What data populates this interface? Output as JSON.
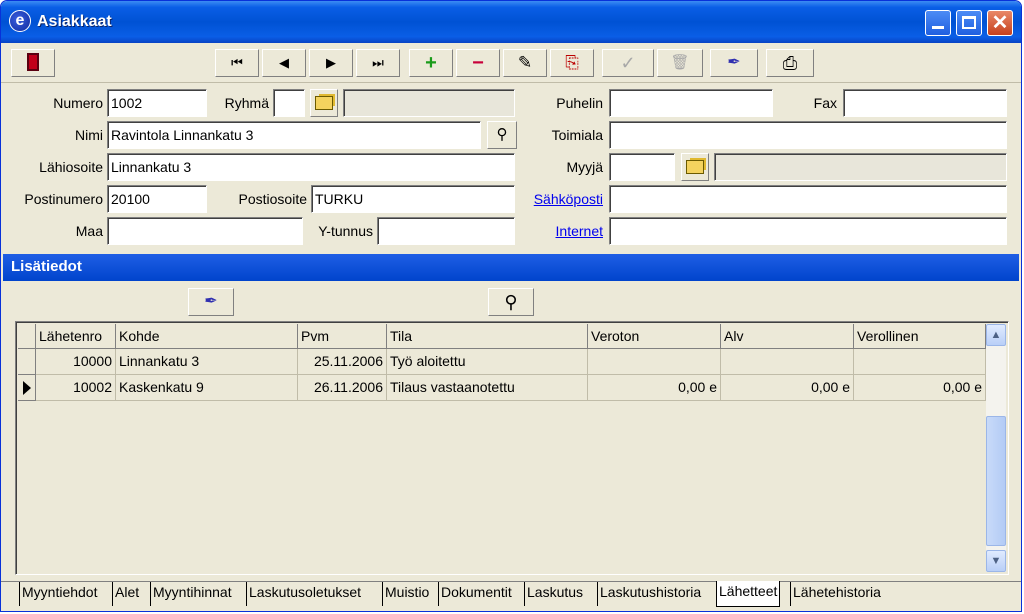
{
  "window": {
    "title": "Asiakkaat"
  },
  "title_controls": {
    "minimize": "minimize",
    "maximize": "maximize",
    "close": "close"
  },
  "toolbar": {
    "buttons": [
      "exit-icon",
      "first-record-icon",
      "previous-record-icon",
      "next-record-icon",
      "last-record-icon",
      "add-icon",
      "delete-icon",
      "edit-icon",
      "copy-icon",
      "confirm-icon",
      "trash-icon",
      "find-icon",
      "print-icon"
    ],
    "glyphs": {
      "first": "⏮",
      "prev": "◀",
      "next": "▶",
      "last": "⏭",
      "add": "+",
      "del": "−",
      "edit": "✎",
      "copy": "⎘",
      "ok": "✓",
      "trash": "🗑",
      "find": "✒",
      "print": "⎙"
    }
  },
  "form": {
    "numero_label": "Numero",
    "numero_value": "1002",
    "ryhma_label": "Ryhmä",
    "ryhma_value": "",
    "ryhma_name": "",
    "puhelin_label": "Puhelin",
    "puhelin_value": "",
    "fax_label": "Fax",
    "fax_value": "",
    "nimi_label": "Nimi",
    "nimi_value": "Ravintola Linnankatu 3",
    "toimiala_label": "Toimiala",
    "toimiala_value": "",
    "lahiosoite_label": "Lähiosoite",
    "lahiosoite_value": "Linnankatu 3",
    "myyja_label": "Myyjä",
    "myyja_value": "",
    "myyja_name": "",
    "postinumero_label": "Postinumero",
    "postinumero_value": "20100",
    "postiosoite_label": "Postiosoite",
    "postiosoite_value": "TURKU",
    "sahkoposti_label": "Sähköposti",
    "sahkoposti_value": "",
    "maa_label": "Maa",
    "maa_value": "",
    "ytunnus_label": "Y-tunnus",
    "ytunnus_value": "",
    "internet_label": "Internet",
    "internet_value": ""
  },
  "section": {
    "title": "Lisätiedot"
  },
  "grid": {
    "columns": [
      "Lähetenro",
      "Kohde",
      "Pvm",
      "Tila",
      "Veroton",
      "Alv",
      "Verollinen"
    ],
    "rows": [
      {
        "lahetenro": "10000",
        "kohde": "Linnankatu 3",
        "pvm": "25.11.2006",
        "tila": "Työ aloitettu",
        "veroton": "",
        "alv": "",
        "verollinen": ""
      },
      {
        "lahetenro": "10002",
        "kohde": "Kaskenkatu 9",
        "pvm": "26.11.2006",
        "tila": "Tilaus vastaanotettu",
        "veroton": "0,00 e",
        "alv": "0,00 e",
        "verollinen": "0,00 e"
      }
    ]
  },
  "tabs": [
    "Myyntiehdot",
    "Alet",
    "Myyntihinnat",
    "Laskutusoletukset",
    "Muistio",
    "Dokumentit",
    "Laskutus",
    "Laskutushistoria",
    "Lähetteet",
    "Lähetehistoria"
  ],
  "active_tab": "Lähetteet"
}
